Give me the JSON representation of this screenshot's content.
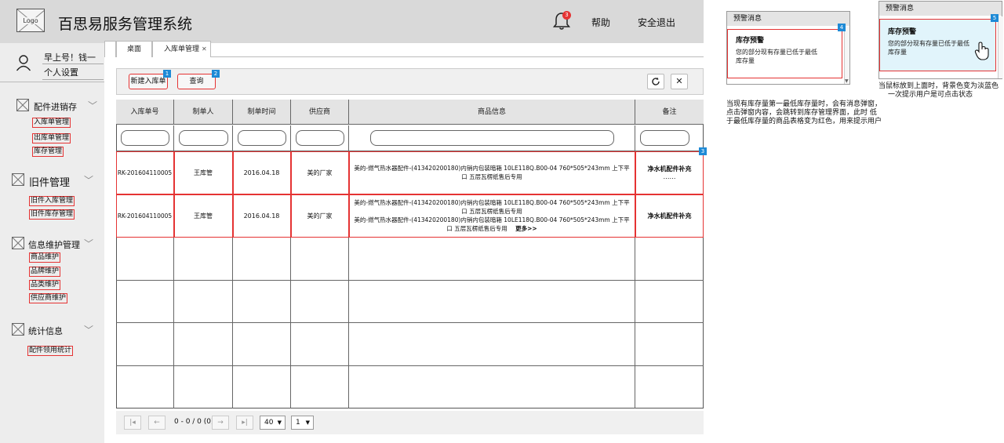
{
  "header": {
    "logo_text": "Logo",
    "title": "百思易服务管理系统",
    "notify_count": "3",
    "help_label": "帮助",
    "logout_label": "安全退出"
  },
  "user": {
    "greeting": "早上号！钱一",
    "personal_settings": "个人设置"
  },
  "sidebar": {
    "sections": [
      {
        "label": "配件进销存",
        "items": [
          "入库单管理",
          "出库单管理",
          "库存管理"
        ]
      },
      {
        "label": "旧件管理",
        "items": [
          "旧件入库管理",
          "旧件库存管理"
        ]
      },
      {
        "label": "信息维护管理",
        "items": [
          "商品维护",
          "品牌维护",
          "品类维护",
          "供应商维护"
        ]
      },
      {
        "label": "统计信息",
        "items": [
          "配件领用统计"
        ]
      }
    ]
  },
  "tabs": [
    {
      "label": "桌面"
    },
    {
      "label": "入库单管理",
      "close": "✕"
    }
  ],
  "toolbar": {
    "new_label": "新建入库单",
    "new_tag": "1",
    "query_label": "查询",
    "query_tag": "2",
    "refresh_icon": "refresh-icon",
    "close_icon": "close-icon"
  },
  "table": {
    "headers": [
      "入库单号",
      "制单人",
      "制单时间",
      "供应商",
      "商品信息",
      "备注"
    ],
    "rows": [
      {
        "no": "RK-201604110005",
        "maker": "王库管",
        "time": "2016.04.18",
        "supplier": "美的厂家",
        "goods_lines": [
          "美的-燃气热水器配件-(413420200180)内销内包装暗箱 10LE118Q.B00-04 760*505*243mm 上下平",
          "口 五层瓦楞纸售后专用"
        ],
        "remark": "净水机配件补充",
        "remark_more": "……",
        "tag": "3"
      },
      {
        "no": "RK-201604110005",
        "maker": "王库管",
        "time": "2016.04.18",
        "supplier": "美的厂家",
        "goods_lines": [
          "美的-燃气热水器配件-(413420200180)内销内包装暗箱 10LE118Q.B00-04 760*505*243mm 上下平",
          "口 五层瓦楞纸售后专用",
          "美的-燃气热水器配件-(413420200180)内销内包装暗箱 10LE118Q.B00-04 760*505*243mm 上下平",
          "口 五层瓦楞纸售后专用"
        ],
        "more": "更多>>",
        "remark": "净水机配件补充"
      }
    ]
  },
  "pager": {
    "info": "0 - 0 / 0 (0)",
    "page_size": "40",
    "page": "1"
  },
  "popup1": {
    "head": "预警消息",
    "title": "库存预警",
    "text_line1": "您的部分现有存量已低于最低",
    "text_line2": "库存量",
    "tag": "4"
  },
  "popup2": {
    "head": "预警消息",
    "title": "库存预警",
    "text_line1": "您的部分现有存量已低于最低",
    "text_line2": "库存量",
    "tag": "5"
  },
  "notes": {
    "note1": [
      "当现有库存量第一最低库存量时，会有消息弹窗，",
      "点击弹窗内容，会跳转到库存管理界面，此时 低",
      "于最低库存量的商品表格变为红色，用来提示用户"
    ],
    "note2": [
      "当鼠标放到上面时，背景色变为淡蓝色",
      "一次提示用户是可点击状态"
    ]
  },
  "colors": {
    "accent_red": "#e53333",
    "tag_blue": "#1e8ad6",
    "hover_bg": "#e1f4fb"
  }
}
